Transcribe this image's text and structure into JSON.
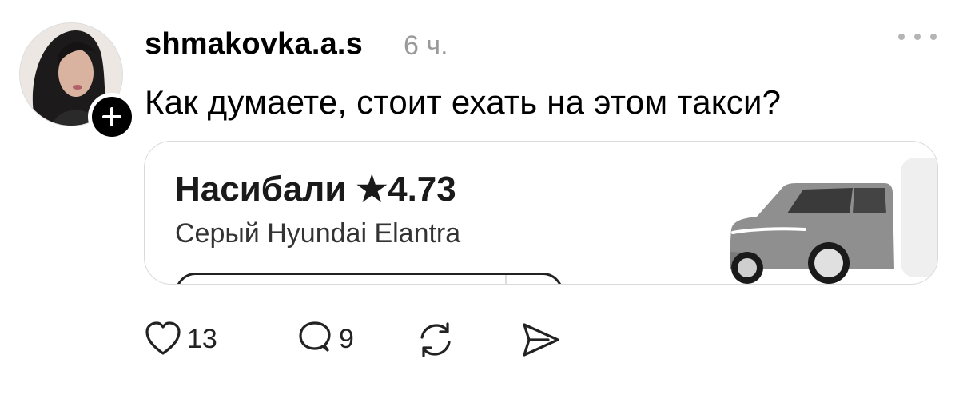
{
  "post": {
    "username": "shmakovka.a.s",
    "time": "6 ч.",
    "text": "Как думаете, стоит ехать на этом такси?"
  },
  "card": {
    "driver_name": "Насибали",
    "star": "★",
    "rating": "4.73",
    "car_model": "Серый Hyundai Elantra"
  },
  "actions": {
    "likes": "13",
    "comments": "9"
  },
  "icons": {
    "follow": "plus-icon",
    "more": "more-horizontal-icon",
    "like": "heart-icon",
    "comment": "comment-icon",
    "repost": "repost-icon",
    "share": "send-icon"
  },
  "colors": {
    "text": "#000000",
    "muted": "#9a9a9a",
    "card_border": "#d9d9d9",
    "car_body": "#8f8f8f"
  }
}
